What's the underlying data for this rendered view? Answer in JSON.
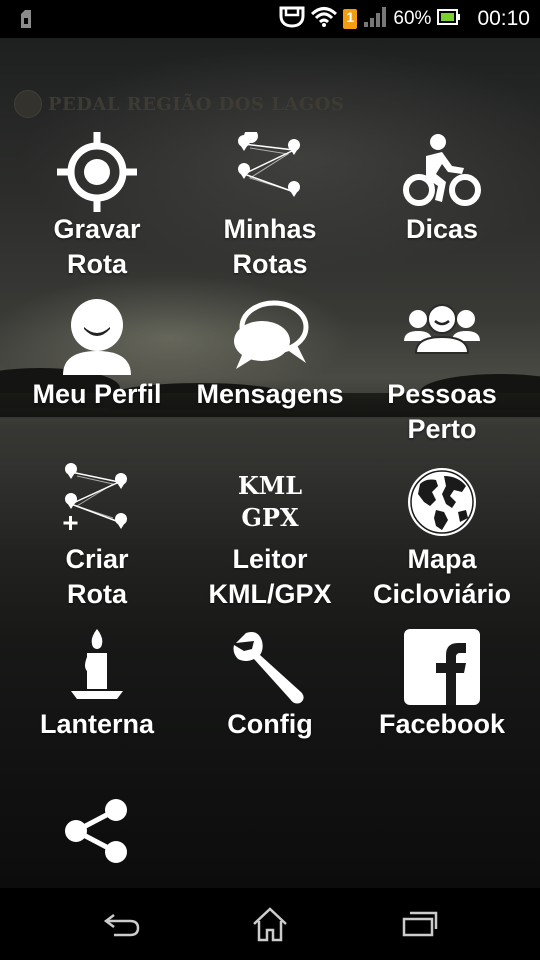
{
  "status_bar": {
    "battery_percent": "60%",
    "time": "00:10",
    "notification_badge": "1",
    "icons": [
      "sd-card-icon",
      "cast-icon",
      "wifi-icon",
      "notification-icon",
      "signal-icon",
      "battery-icon"
    ]
  },
  "watermark": {
    "text": "PEDAL REGIÃO DOS LAGOS"
  },
  "menu": {
    "items": [
      {
        "label_line1": "Gravar",
        "label_line2": "Rota",
        "icon": "gps-target-icon"
      },
      {
        "label_line1": "Minhas",
        "label_line2": "Rotas",
        "icon": "route-icon"
      },
      {
        "label_line1": "Dicas",
        "label_line2": "",
        "icon": "cyclist-icon"
      },
      {
        "label_line1": "Meu Perfil",
        "label_line2": "",
        "icon": "person-icon"
      },
      {
        "label_line1": "Mensagens",
        "label_line2": "",
        "icon": "chat-bubbles-icon"
      },
      {
        "label_line1": "Pessoas",
        "label_line2": "Perto",
        "icon": "people-group-icon"
      },
      {
        "label_line1": "Criar",
        "label_line2": "Rota",
        "icon": "create-route-icon"
      },
      {
        "label_line1": "Leitor",
        "label_line2": "KML/GPX",
        "icon": "kml-gpx-icon",
        "icon_text_1": "KML",
        "icon_text_2": "GPX"
      },
      {
        "label_line1": "Mapa",
        "label_line2": "Cicloviário",
        "icon": "globe-icon"
      },
      {
        "label_line1": "Lanterna",
        "label_line2": "",
        "icon": "candle-icon"
      },
      {
        "label_line1": "Config",
        "label_line2": "",
        "icon": "wrench-icon"
      },
      {
        "label_line1": "Facebook",
        "label_line2": "",
        "icon": "facebook-icon"
      },
      {
        "label_line1": "",
        "label_line2": "",
        "icon": "share-icon"
      }
    ]
  },
  "nav_bar": {
    "buttons": [
      "back-icon",
      "home-icon",
      "recents-icon"
    ]
  },
  "colors": {
    "text": "#ffffff",
    "background": "#000000"
  }
}
